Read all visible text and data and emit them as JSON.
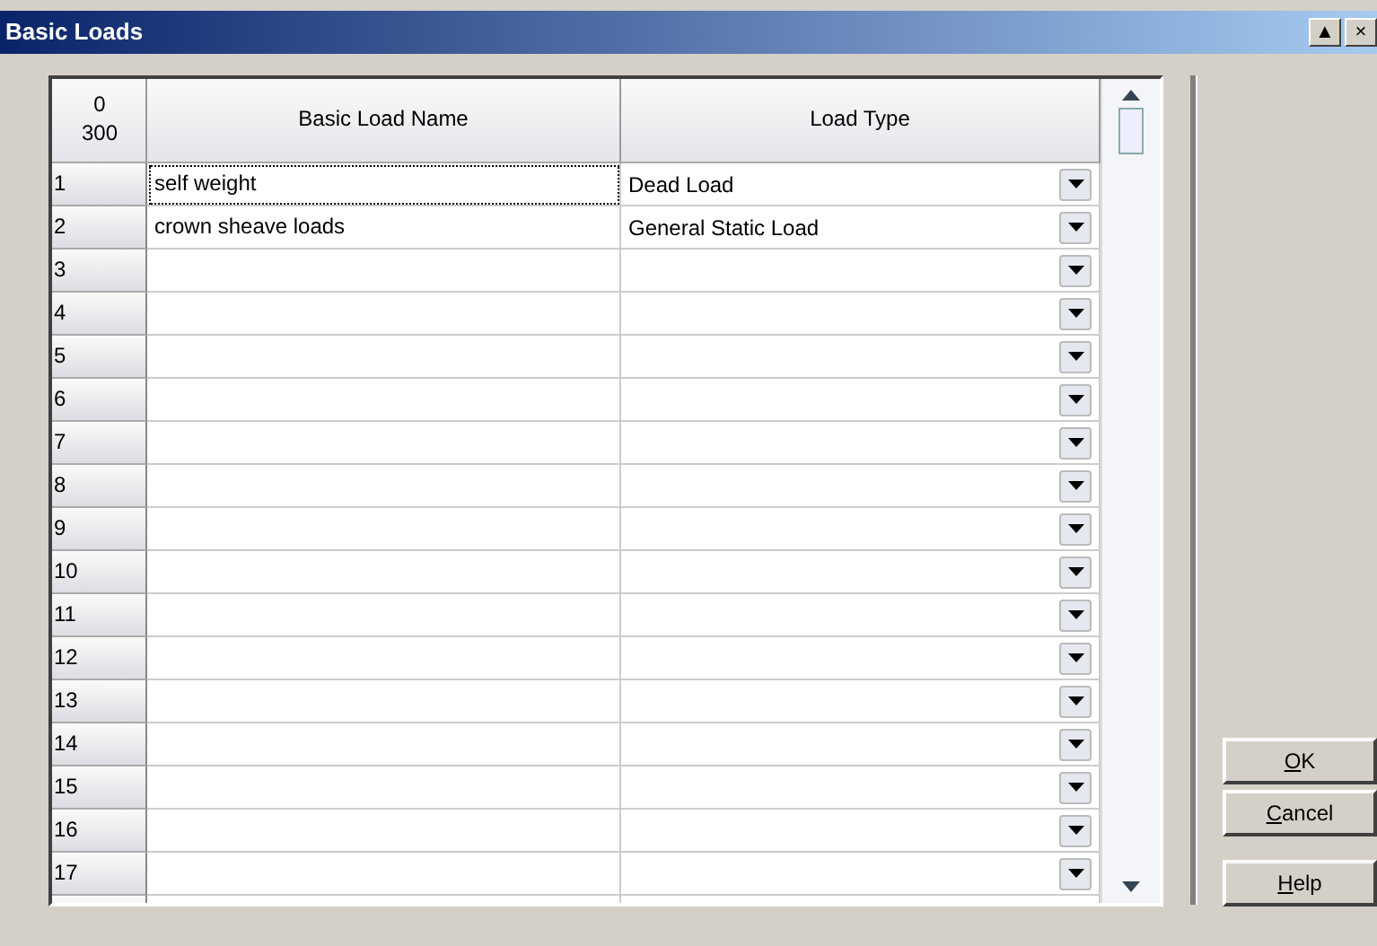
{
  "window": {
    "title": "Basic Loads",
    "controls": [
      "▲",
      "×"
    ]
  },
  "grid": {
    "corner": [
      "0",
      "300"
    ],
    "columns": [
      "Basic Load Name",
      "Load Type"
    ],
    "rows": [
      {
        "number": "1",
        "name": "self weight",
        "type": "Dead Load",
        "focused": true
      },
      {
        "number": "2",
        "name": "crown sheave loads",
        "type": "General Static Load",
        "focused": false
      },
      {
        "number": "3",
        "name": "",
        "type": "",
        "focused": false
      },
      {
        "number": "4",
        "name": "",
        "type": "",
        "focused": false
      },
      {
        "number": "5",
        "name": "",
        "type": "",
        "focused": false
      },
      {
        "number": "6",
        "name": "",
        "type": "",
        "focused": false
      },
      {
        "number": "7",
        "name": "",
        "type": "",
        "focused": false
      },
      {
        "number": "8",
        "name": "",
        "type": "",
        "focused": false
      },
      {
        "number": "9",
        "name": "",
        "type": "",
        "focused": false
      },
      {
        "number": "10",
        "name": "",
        "type": "",
        "focused": false
      },
      {
        "number": "11",
        "name": "",
        "type": "",
        "focused": false
      },
      {
        "number": "12",
        "name": "",
        "type": "",
        "focused": false
      },
      {
        "number": "13",
        "name": "",
        "type": "",
        "focused": false
      },
      {
        "number": "14",
        "name": "",
        "type": "",
        "focused": false
      },
      {
        "number": "15",
        "name": "",
        "type": "",
        "focused": false
      },
      {
        "number": "16",
        "name": "",
        "type": "",
        "focused": false
      },
      {
        "number": "17",
        "name": "",
        "type": "",
        "focused": false
      }
    ]
  },
  "buttons": [
    {
      "label": "OK",
      "mnemonic_first": true
    },
    {
      "label": "Cancel",
      "mnemonic_first": true
    },
    {
      "label": "Help",
      "mnemonic_first": true
    }
  ]
}
